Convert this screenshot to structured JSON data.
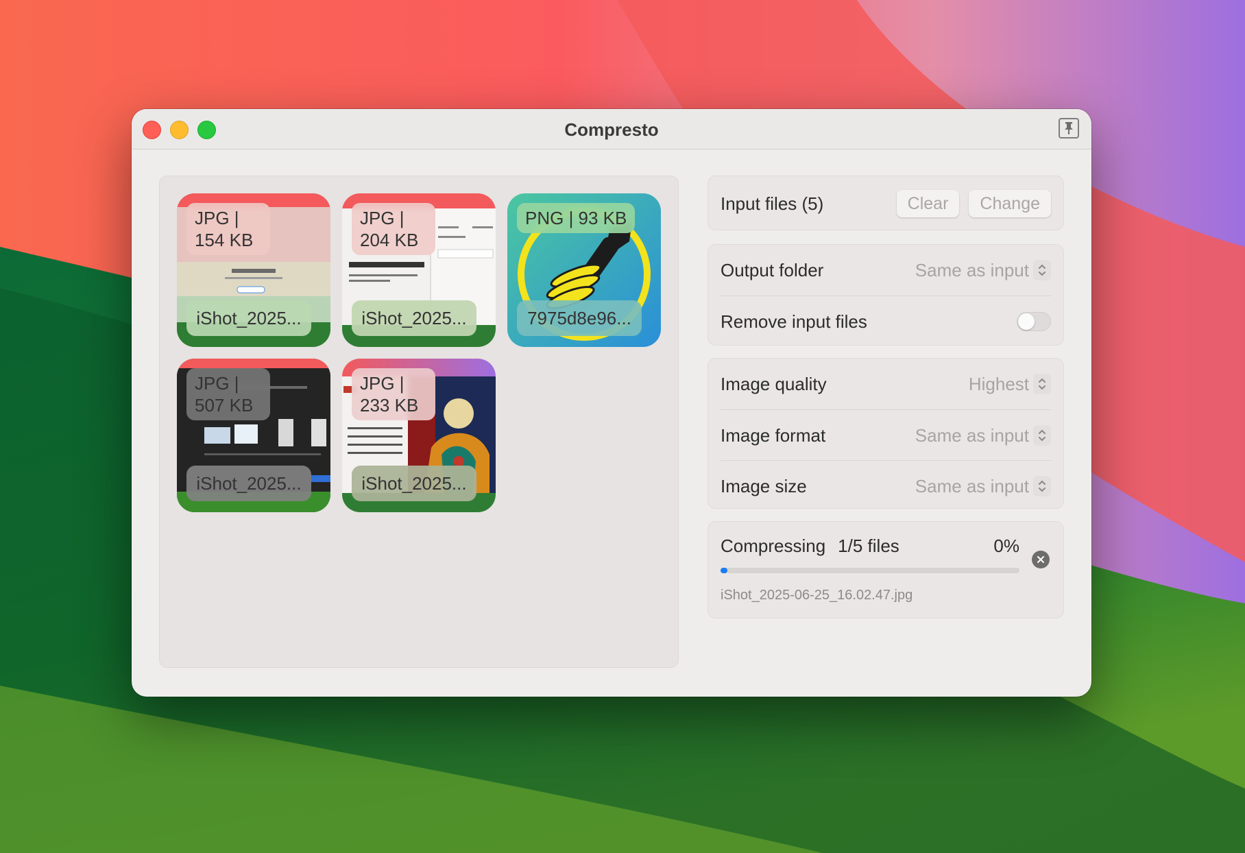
{
  "window": {
    "title": "Compresto"
  },
  "thumbnails": [
    {
      "badge": "JPG | 154 KB",
      "filename": "iShot_2025..."
    },
    {
      "badge": "JPG | 204 KB",
      "filename": "iShot_2025..."
    },
    {
      "badge": "PNG | 93 KB",
      "filename": "7975d8e96..."
    },
    {
      "badge": "JPG | 507 KB",
      "filename": "iShot_2025..."
    },
    {
      "badge": "JPG | 233 KB",
      "filename": "iShot_2025..."
    }
  ],
  "input_files": {
    "label": "Input files (5)",
    "clear_label": "Clear",
    "change_label": "Change"
  },
  "output": {
    "folder_label": "Output folder",
    "folder_value": "Same as input",
    "remove_label": "Remove input files",
    "remove_enabled": false
  },
  "image": {
    "quality_label": "Image quality",
    "quality_value": "Highest",
    "format_label": "Image format",
    "format_value": "Same as input",
    "size_label": "Image size",
    "size_value": "Same as input"
  },
  "progress": {
    "status_label": "Compressing",
    "files_label": "1/5 files",
    "percent_label": "0%",
    "percent": 0,
    "current_file": "iShot_2025-06-25_16.02.47.jpg"
  },
  "colors": {
    "accent": "#1a7cf2",
    "close": "#fe5f57",
    "minimize": "#febc2e",
    "maximize": "#28c840"
  },
  "icons": {
    "pin": "pin-icon",
    "stepper": "chevron-up-down-icon",
    "cancel": "xmark-circle-icon"
  }
}
